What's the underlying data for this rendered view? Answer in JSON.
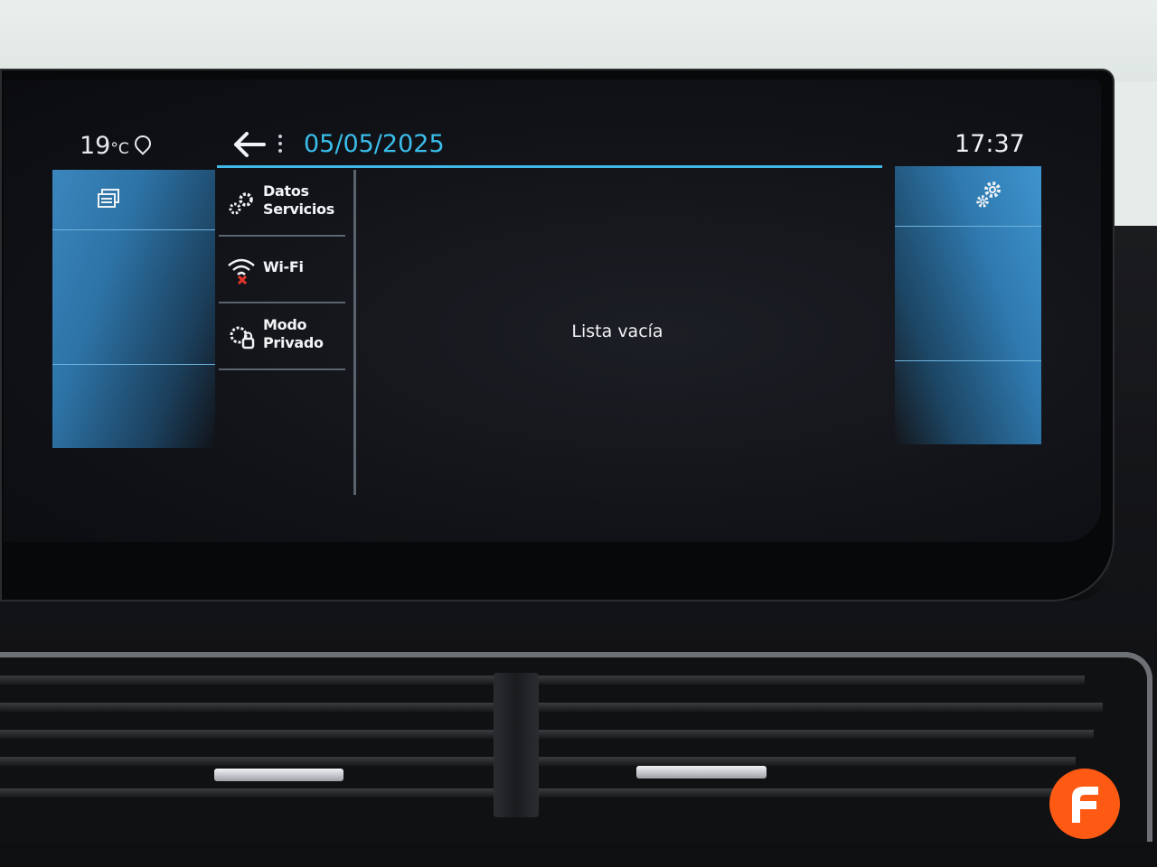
{
  "status_bar": {
    "temperature": "19",
    "temperature_unit": "°C",
    "date": "05/05/2025",
    "time": "17:37"
  },
  "menu": {
    "items": [
      {
        "label": "Datos\nServicios",
        "icon": "gear-pair-icon"
      },
      {
        "label": "Wi-Fi",
        "icon": "wifi-disabled-icon"
      },
      {
        "label": "Modo\nPrivado",
        "icon": "private-mode-icon"
      }
    ]
  },
  "content": {
    "empty_message": "Lista vacía"
  },
  "colors": {
    "accent": "#3bbdeb",
    "panel_blue": "#2f7ab0",
    "logo_orange": "#ff5a14"
  }
}
